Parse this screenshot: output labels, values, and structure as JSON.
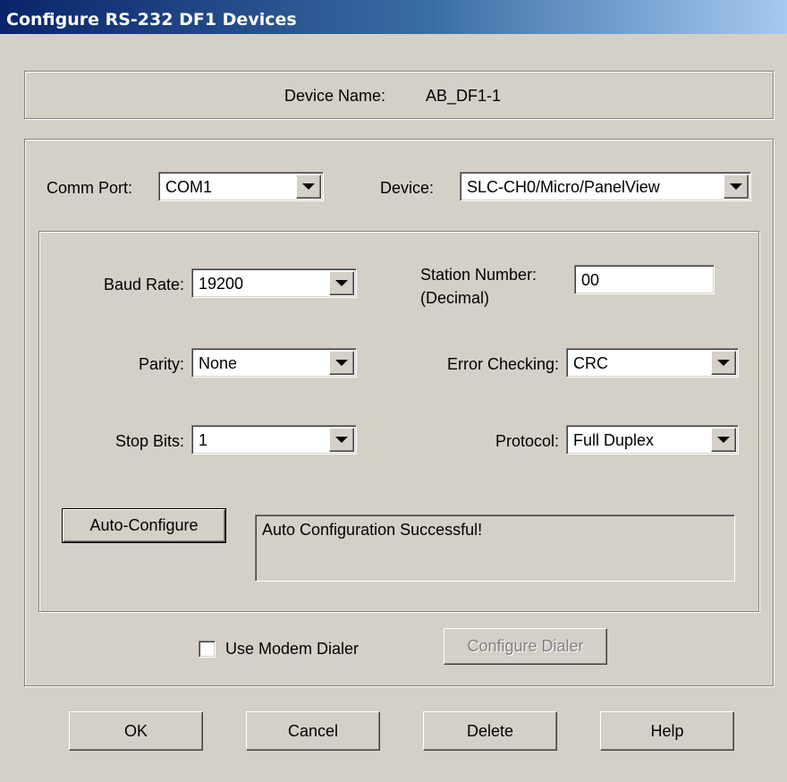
{
  "window": {
    "title": "Configure RS-232 DF1 Devices"
  },
  "device_name": {
    "label": "Device Name:",
    "value": "AB_DF1-1"
  },
  "comm_port": {
    "label": "Comm Port:",
    "value": "COM1"
  },
  "device": {
    "label": "Device:",
    "value": "SLC-CH0/Micro/PanelView"
  },
  "baud_rate": {
    "label": "Baud Rate:",
    "value": "19200"
  },
  "station_number": {
    "label_line1": "Station Number:",
    "label_line2": "(Decimal)",
    "value": "00"
  },
  "parity": {
    "label": "Parity:",
    "value": "None"
  },
  "error_checking": {
    "label": "Error Checking:",
    "value": "CRC"
  },
  "stop_bits": {
    "label": "Stop Bits:",
    "value": "1"
  },
  "protocol": {
    "label": "Protocol:",
    "value": "Full Duplex"
  },
  "auto_configure": {
    "label": "Auto-Configure",
    "status": "Auto Configuration Successful!"
  },
  "modem": {
    "checkbox_label": "Use Modem Dialer",
    "checked": false,
    "configure_label": "Configure Dialer"
  },
  "buttons": {
    "ok": "OK",
    "cancel": "Cancel",
    "delete": "Delete",
    "help": "Help"
  },
  "colors": {
    "title_start": "#0a246a",
    "title_end": "#a6caf0",
    "face": "#d4d0c8"
  }
}
